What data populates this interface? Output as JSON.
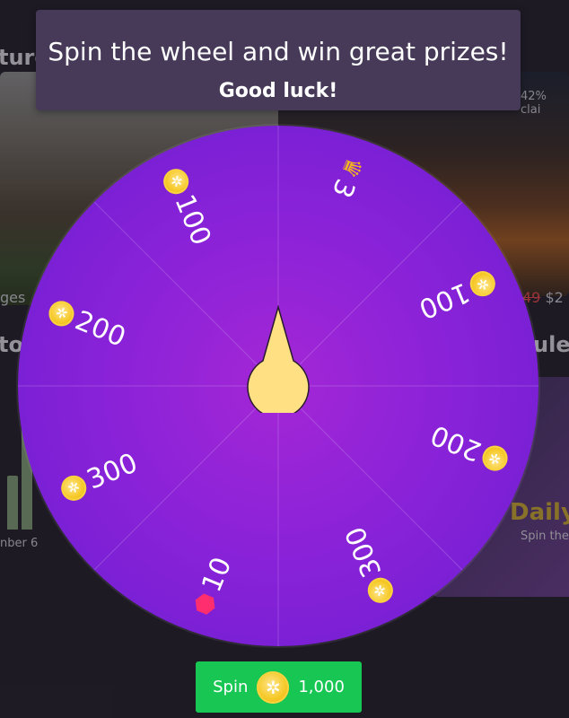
{
  "background": {
    "heading_left_1": "ture",
    "heading_left_2": "to",
    "heading_right": "ule",
    "caption_left": "ges",
    "caption_bottom": "nber 6",
    "claim_text": "42% clai",
    "price_old": "49",
    "price_new": "$2",
    "daily_title": "Daily",
    "daily_sub": "Spin the"
  },
  "banner": {
    "line1": "Spin the wheel and win great prizes!",
    "line2": "Good luck!"
  },
  "wheel": {
    "segments": [
      {
        "amount": "3",
        "icon": "crown-icon"
      },
      {
        "amount": "100",
        "icon": "coin-icon"
      },
      {
        "amount": "200",
        "icon": "coin-icon"
      },
      {
        "amount": "300",
        "icon": "coin-icon"
      },
      {
        "amount": "10",
        "icon": "gem-icon"
      },
      {
        "amount": "300",
        "icon": "coin-icon"
      },
      {
        "amount": "200",
        "icon": "coin-icon"
      },
      {
        "amount": "100",
        "icon": "coin-icon"
      }
    ]
  },
  "spin_button": {
    "label": "Spin",
    "cost": "1,000"
  },
  "colors": {
    "wheel": "#8a22d8",
    "pointer": "#ffe082",
    "spin_button": "#18c653",
    "banner": "#463a58"
  }
}
